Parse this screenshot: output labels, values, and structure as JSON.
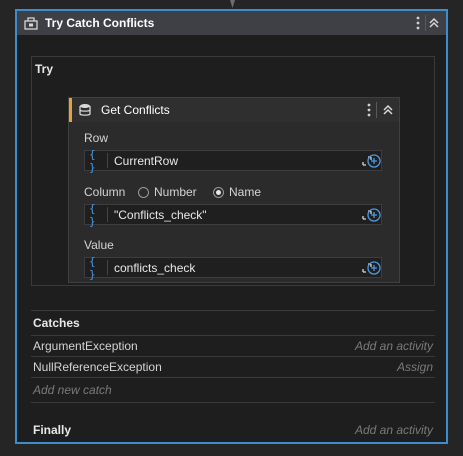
{
  "outer": {
    "title": "Try Catch Conflicts"
  },
  "try": {
    "label": "Try"
  },
  "activity": {
    "title": "Get Conflicts",
    "row_label": "Row",
    "row_value": "CurrentRow",
    "column_label": "Column",
    "column_options": [
      "Number",
      "Name"
    ],
    "column_selected": "Name",
    "column_value": "\"Conflicts_check\"",
    "value_label": "Value",
    "value_value": "conflicts_check"
  },
  "catches": {
    "label": "Catches",
    "items": [
      {
        "name": "ArgumentException",
        "action": "Add an activity"
      },
      {
        "name": "NullReferenceException",
        "action": "Assign"
      }
    ],
    "add_new": "Add new catch"
  },
  "finally": {
    "label": "Finally",
    "action": "Add an activity"
  },
  "colors": {
    "accent": "#3c8dcf",
    "activity_marker": "#e6a23c",
    "expression_brace": "#4d9ae0"
  }
}
